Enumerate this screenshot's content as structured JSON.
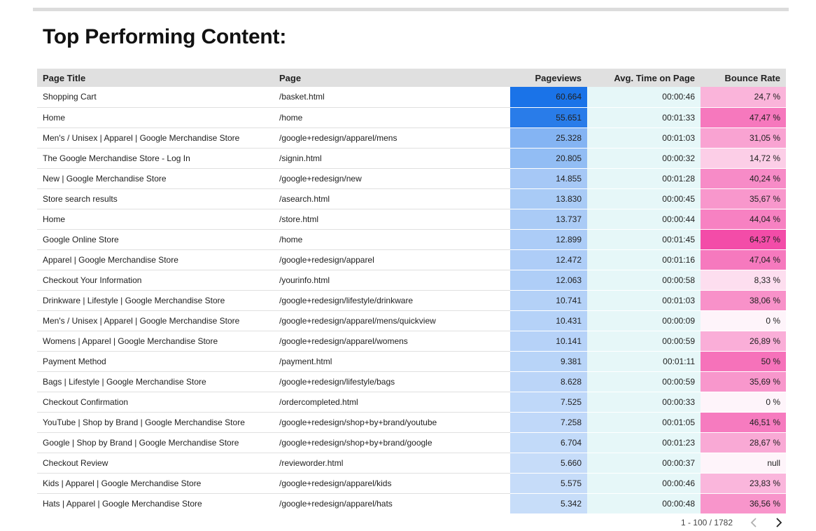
{
  "title": "Top Performing Content:",
  "table": {
    "columns": [
      "Page Title",
      "Page",
      "Pageviews",
      "Avg. Time on Page",
      "Bounce Rate"
    ],
    "rows": [
      {
        "title": "Shopping Cart",
        "page": "/basket.html",
        "views": "60.664",
        "time": "00:00:46",
        "bounce": "24,7 %",
        "views_num": 60664,
        "bounce_num": 24.7
      },
      {
        "title": "Home",
        "page": "/home",
        "views": "55.651",
        "time": "00:01:33",
        "bounce": "47,47 %",
        "views_num": 55651,
        "bounce_num": 47.47
      },
      {
        "title": "Men's / Unisex | Apparel | Google Merchandise Store",
        "page": "/google+redesign/apparel/mens",
        "views": "25.328",
        "time": "00:01:03",
        "bounce": "31,05 %",
        "views_num": 25328,
        "bounce_num": 31.05
      },
      {
        "title": "The Google Merchandise Store - Log In",
        "page": "/signin.html",
        "views": "20.805",
        "time": "00:00:32",
        "bounce": "14,72 %",
        "views_num": 20805,
        "bounce_num": 14.72
      },
      {
        "title": "New | Google Merchandise Store",
        "page": "/google+redesign/new",
        "views": "14.855",
        "time": "00:01:28",
        "bounce": "40,24 %",
        "views_num": 14855,
        "bounce_num": 40.24
      },
      {
        "title": "Store search results",
        "page": "/asearch.html",
        "views": "13.830",
        "time": "00:00:45",
        "bounce": "35,67 %",
        "views_num": 13830,
        "bounce_num": 35.67
      },
      {
        "title": "Home",
        "page": "/store.html",
        "views": "13.737",
        "time": "00:00:44",
        "bounce": "44,04 %",
        "views_num": 13737,
        "bounce_num": 44.04
      },
      {
        "title": "Google Online Store",
        "page": "/home",
        "views": "12.899",
        "time": "00:01:45",
        "bounce": "64,37 %",
        "views_num": 12899,
        "bounce_num": 64.37
      },
      {
        "title": "Apparel | Google Merchandise Store",
        "page": "/google+redesign/apparel",
        "views": "12.472",
        "time": "00:01:16",
        "bounce": "47,04 %",
        "views_num": 12472,
        "bounce_num": 47.04
      },
      {
        "title": "Checkout Your Information",
        "page": "/yourinfo.html",
        "views": "12.063",
        "time": "00:00:58",
        "bounce": "8,33 %",
        "views_num": 12063,
        "bounce_num": 8.33
      },
      {
        "title": "Drinkware | Lifestyle | Google Merchandise Store",
        "page": "/google+redesign/lifestyle/drinkware",
        "views": "10.741",
        "time": "00:01:03",
        "bounce": "38,06 %",
        "views_num": 10741,
        "bounce_num": 38.06
      },
      {
        "title": "Men's / Unisex | Apparel | Google Merchandise Store",
        "page": "/google+redesign/apparel/mens/quickview",
        "views": "10.431",
        "time": "00:00:09",
        "bounce": "0 %",
        "views_num": 10431,
        "bounce_num": 0
      },
      {
        "title": "Womens | Apparel | Google Merchandise Store",
        "page": "/google+redesign/apparel/womens",
        "views": "10.141",
        "time": "00:00:59",
        "bounce": "26,89 %",
        "views_num": 10141,
        "bounce_num": 26.89
      },
      {
        "title": "Payment Method",
        "page": "/payment.html",
        "views": "9.381",
        "time": "00:01:11",
        "bounce": "50 %",
        "views_num": 9381,
        "bounce_num": 50
      },
      {
        "title": "Bags | Lifestyle | Google Merchandise Store",
        "page": "/google+redesign/lifestyle/bags",
        "views": "8.628",
        "time": "00:00:59",
        "bounce": "35,69 %",
        "views_num": 8628,
        "bounce_num": 35.69
      },
      {
        "title": "Checkout Confirmation",
        "page": "/ordercompleted.html",
        "views": "7.525",
        "time": "00:00:33",
        "bounce": "0 %",
        "views_num": 7525,
        "bounce_num": 0
      },
      {
        "title": "YouTube | Shop by Brand | Google Merchandise Store",
        "page": "/google+redesign/shop+by+brand/youtube",
        "views": "7.258",
        "time": "00:01:05",
        "bounce": "46,51 %",
        "views_num": 7258,
        "bounce_num": 46.51
      },
      {
        "title": "Google | Shop by Brand | Google Merchandise Store",
        "page": "/google+redesign/shop+by+brand/google",
        "views": "6.704",
        "time": "00:01:23",
        "bounce": "28,67 %",
        "views_num": 6704,
        "bounce_num": 28.67
      },
      {
        "title": "Checkout Review",
        "page": "/revieworder.html",
        "views": "5.660",
        "time": "00:00:37",
        "bounce": "null",
        "views_num": 5660,
        "bounce_num": 0
      },
      {
        "title": "Kids | Apparel | Google Merchandise Store",
        "page": "/google+redesign/apparel/kids",
        "views": "5.575",
        "time": "00:00:46",
        "bounce": "23,83 %",
        "views_num": 5575,
        "bounce_num": 23.83
      },
      {
        "title": "Hats | Apparel | Google Merchandise Store",
        "page": "/google+redesign/apparel/hats",
        "views": "5.342",
        "time": "00:00:48",
        "bounce": "36,56 %",
        "views_num": 5342,
        "bounce_num": 36.56
      }
    ]
  },
  "pagination": {
    "label": "1 - 100 / 1782"
  },
  "colors": {
    "pageviews_heat": "#1a73e8",
    "time_heat": "#e6f7f8",
    "bounce_heat": "#f34ca8",
    "header_bg": "#e0e0e0"
  },
  "icons": {
    "prev": "chevron-left-icon",
    "next": "chevron-right-icon"
  }
}
